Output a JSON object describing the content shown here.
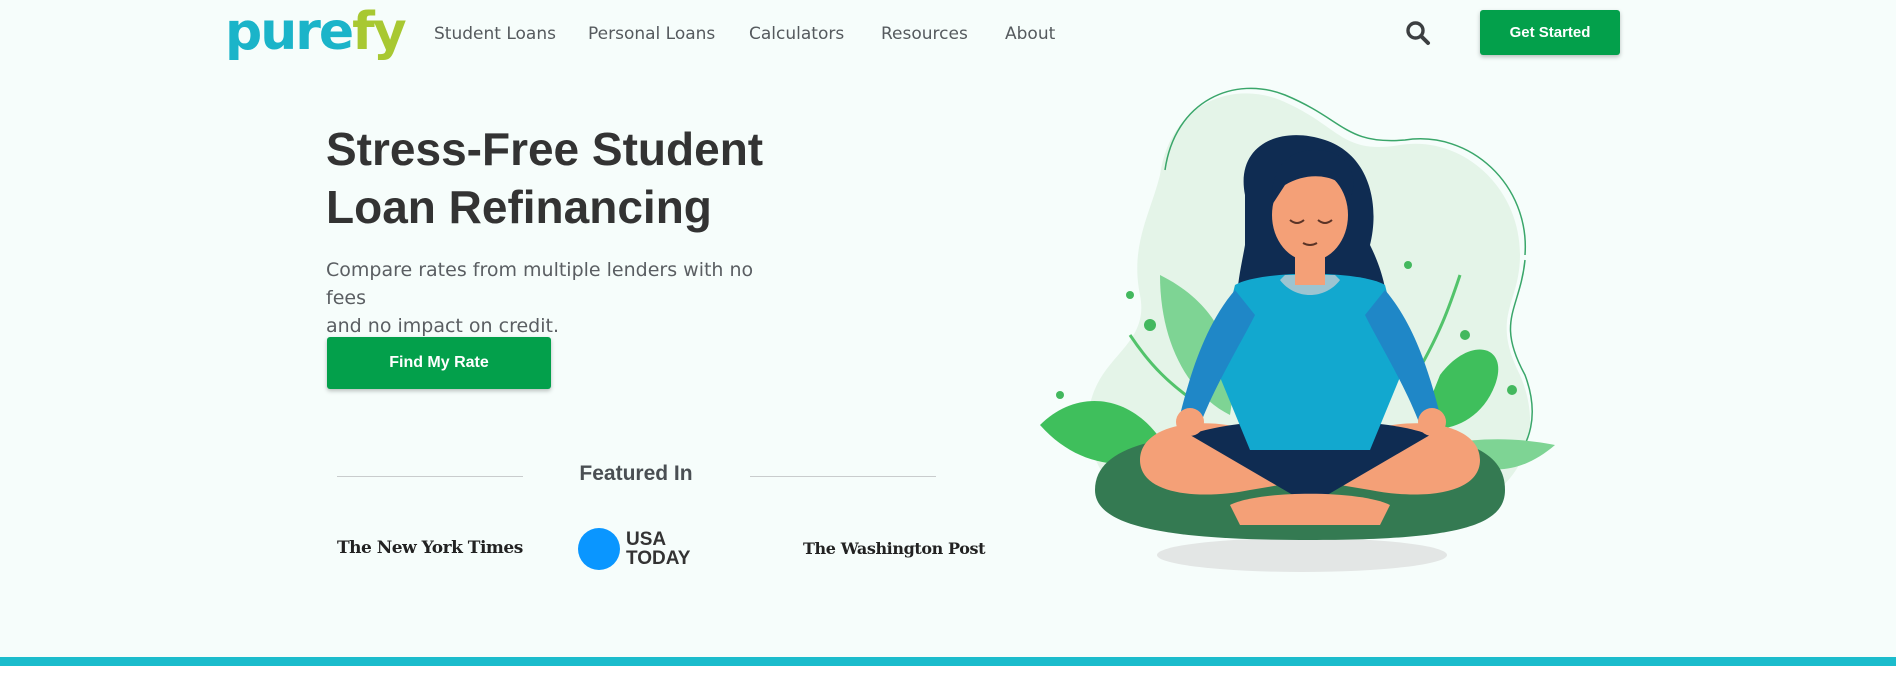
{
  "logo": {
    "part1": "pure",
    "part2": "fy"
  },
  "nav": {
    "items": [
      "Student Loans",
      "Personal Loans",
      "Calculators",
      "Resources",
      "About"
    ]
  },
  "header": {
    "cta_label": "Get Started"
  },
  "hero": {
    "headline_line1": "Stress-Free Student",
    "headline_line2": "Loan Refinancing",
    "sub_line1": "Compare rates from multiple lenders with no fees",
    "sub_line2": "and no impact on credit.",
    "cta_label": "Find My Rate"
  },
  "featured": {
    "title": "Featured In",
    "logos": [
      "The New York Times",
      "USA TODAY",
      "The Washington Post"
    ],
    "usa_line1": "USA",
    "usa_line2": "TODAY"
  },
  "colors": {
    "brand_green": "#03a04b",
    "logo_teal": "#1bb4c9",
    "logo_lime": "#a8c832",
    "stripe": "#1bbccc"
  },
  "icons": [
    "search-icon"
  ]
}
